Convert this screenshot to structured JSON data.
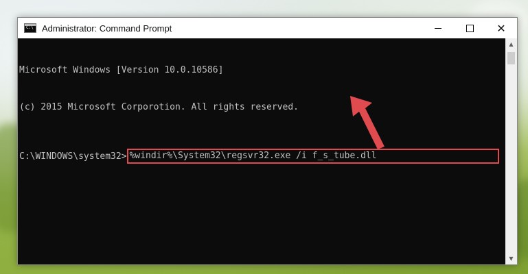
{
  "window": {
    "title": "Administrator: Command Prompt",
    "icon": "console-icon",
    "controls": {
      "minimize": "minimize-icon",
      "maximize": "maximize-icon",
      "close": "close-icon",
      "close_glyph": "✕"
    }
  },
  "console": {
    "lines": [
      "Microsoft Windows [Version 10.0.10586]",
      "(c) 2015 Microsoft Corporotion. All rights reserved."
    ],
    "prompt": "C:\\WINDOWS\\system32>",
    "command": "%windir%\\System32\\regsvr32.exe /i f_s_tube.dll"
  },
  "scrollbar": {
    "up_glyph": "▲",
    "down_glyph": "▼"
  },
  "colors": {
    "highlight_border": "#e04b50",
    "arrow": "#e04b50",
    "console_bg": "#0c0c0c",
    "console_text": "#c0c0c0"
  }
}
